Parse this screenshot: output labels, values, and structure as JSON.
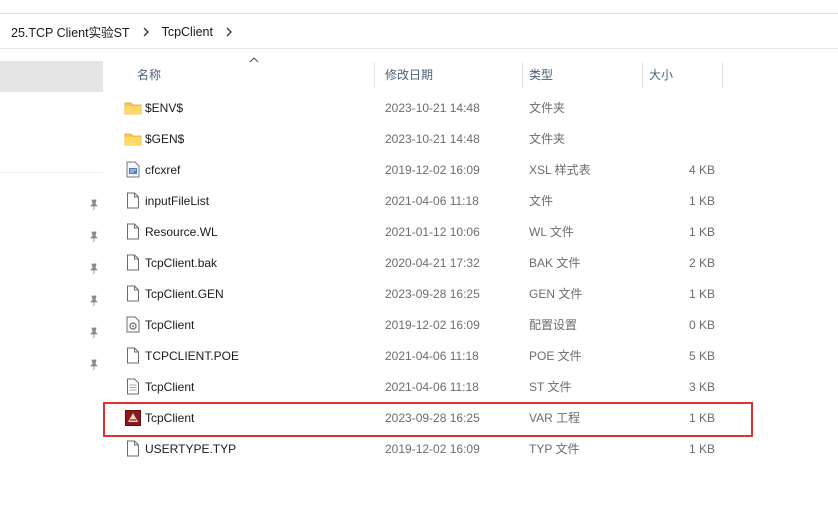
{
  "breadcrumb": {
    "items": [
      "25.TCP Client实验ST",
      "TcpClient"
    ]
  },
  "columns": {
    "name": "名称",
    "date": "修改日期",
    "type": "类型",
    "size": "大小"
  },
  "files": [
    {
      "icon": "folder-icon",
      "name": "$ENV$",
      "date": "2023-10-21 14:48",
      "type": "文件夹",
      "size": ""
    },
    {
      "icon": "folder-icon",
      "name": "$GEN$",
      "date": "2023-10-21 14:48",
      "type": "文件夹",
      "size": ""
    },
    {
      "icon": "xsl-file-icon",
      "name": "cfcxref",
      "date": "2019-12-02 16:09",
      "type": "XSL 样式表",
      "size": "4 KB"
    },
    {
      "icon": "file-icon",
      "name": "inputFileList",
      "date": "2021-04-06 11:18",
      "type": "文件",
      "size": "1 KB"
    },
    {
      "icon": "file-icon",
      "name": "Resource.WL",
      "date": "2021-01-12 10:06",
      "type": "WL 文件",
      "size": "1 KB"
    },
    {
      "icon": "file-icon",
      "name": "TcpClient.bak",
      "date": "2020-04-21 17:32",
      "type": "BAK 文件",
      "size": "2 KB"
    },
    {
      "icon": "file-icon",
      "name": "TcpClient.GEN",
      "date": "2023-09-28 16:25",
      "type": "GEN 文件",
      "size": "1 KB"
    },
    {
      "icon": "config-file-icon",
      "name": "TcpClient",
      "date": "2019-12-02 16:09",
      "type": "配置设置",
      "size": "0 KB"
    },
    {
      "icon": "file-icon",
      "name": "TCPCLIENT.POE",
      "date": "2021-04-06 11:18",
      "type": "POE 文件",
      "size": "5 KB"
    },
    {
      "icon": "text-file-icon",
      "name": "TcpClient",
      "date": "2021-04-06 11:18",
      "type": "ST 文件",
      "size": "3 KB"
    },
    {
      "icon": "var-project-icon",
      "name": "TcpClient",
      "date": "2023-09-28 16:25",
      "type": "VAR 工程",
      "size": "1 KB"
    },
    {
      "icon": "file-icon",
      "name": "USERTYPE.TYP",
      "date": "2019-12-02 16:09",
      "type": "TYP 文件",
      "size": "1 KB"
    }
  ],
  "colors": {
    "highlight": "#e0302f",
    "folder": "#f7c948",
    "selected_nav": "#e5e5e5",
    "header_text": "#4c607a"
  }
}
